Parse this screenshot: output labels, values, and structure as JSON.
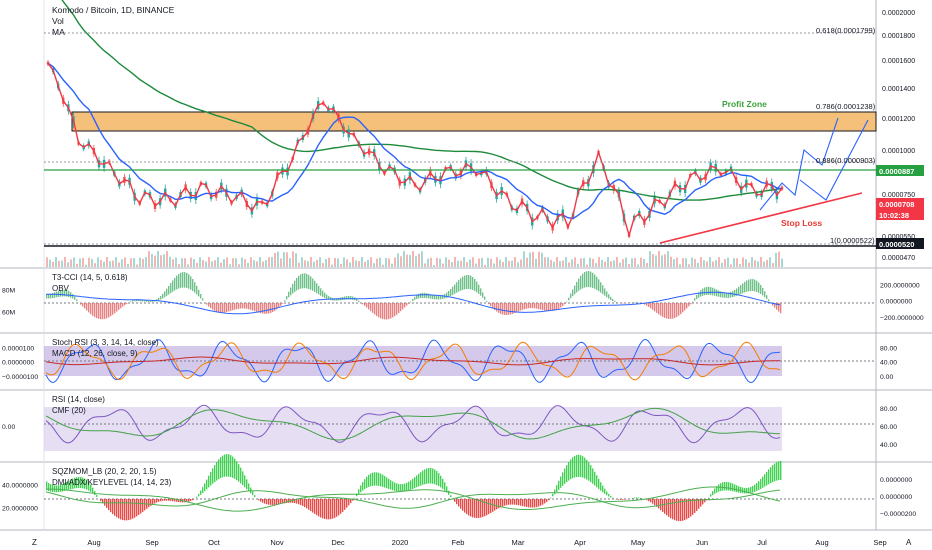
{
  "header": {
    "title": "Komodo / Bitcoin, 1D, BINANCE",
    "studies": [
      "Vol",
      "MA"
    ]
  },
  "colors": {
    "price_line": "#f23645",
    "ma_fast": "#2962ff",
    "ma_slow": "#1e8a3c",
    "zone_fill": "#f5c07a",
    "profit_text": "#3aa33a",
    "stop_text": "#e53935",
    "up": "#26a69a",
    "down": "#ef5350",
    "dark_label": "#131722",
    "green_label": "#26a040"
  },
  "annotations": {
    "profit_zone": "Profit Zone",
    "stop_loss": "Stop Loss"
  },
  "fib_levels": [
    {
      "label": "0.618(0.0001799)",
      "price": 0.0001799
    },
    {
      "label": "0.786(0.0001238)",
      "price": 0.0001238
    },
    {
      "label": "0.886(0.0000903)",
      "price": 9.03e-05
    },
    {
      "label": "1(0.0000522)",
      "price": 5.22e-05
    }
  ],
  "price_badges": [
    {
      "text": "0.0000887",
      "kind": "green"
    },
    {
      "text": "0.0000708",
      "kind": "red"
    },
    {
      "text": "10:02:38",
      "kind": "red"
    },
    {
      "text": "0.0000520",
      "kind": "dark"
    }
  ],
  "price_axis": [
    "0.0002000",
    "0.0001800",
    "0.0001600",
    "0.0001400",
    "0.0001200",
    "0.0001000",
    "0.0000850",
    "0.0000750",
    "0.0000650",
    "0.0000550",
    "0.0000470"
  ],
  "panels": {
    "t3cci": {
      "title": "T3-CCI (14, 5, 0.618)",
      "sub": "OBV",
      "left_ticks": [
        "80M",
        "60M"
      ],
      "right_ticks": [
        "200.0000000",
        "0.0000000",
        "−200.0000000"
      ]
    },
    "stoch": {
      "title": "Stoch RSI (3, 3, 14, 14, close)",
      "sub": "MACD (12, 26, close, 9)",
      "left_ticks": [
        "0.0000100",
        "0.0000000",
        "−0.0000100"
      ],
      "right_ticks": [
        "80.00",
        "40.00",
        "0.00"
      ]
    },
    "rsi": {
      "title": "RSI (14, close)",
      "sub": "CMF (20)",
      "left_ticks": [
        "0.00"
      ],
      "right_ticks": [
        "80.00",
        "60.00",
        "40.00"
      ]
    },
    "sqz": {
      "title": "SQZMOM_LB (20, 2, 20, 1.5)",
      "sub": "DMI/ADX/KEYLEVEL (14, 14, 23)",
      "left_ticks": [
        "40.0000000",
        "20.0000000"
      ],
      "right_ticks": [
        "0.0000000",
        "0.0000000",
        "−0.0000200"
      ]
    }
  },
  "time_axis": [
    "Aug",
    "Sep",
    "Oct",
    "Nov",
    "Dec",
    "2020",
    "Feb",
    "Mar",
    "Apr",
    "May",
    "Jun",
    "Jul",
    "Aug",
    "Sep"
  ],
  "corner_left": "Z",
  "corner_right": "A",
  "chart_data": {
    "type": "line",
    "title": "Komodo / Bitcoin, 1D, BINANCE",
    "x": [
      "Jul",
      "Aug",
      "Aug",
      "Sep",
      "Sep",
      "Oct",
      "Oct",
      "Nov",
      "Nov",
      "Dec",
      "Dec",
      "2020",
      "Jan",
      "Feb",
      "Feb",
      "Mar",
      "Mar",
      "Apr",
      "Apr",
      "May",
      "May",
      "Jun",
      "Jun",
      "Jul",
      "Jul"
    ],
    "series": [
      {
        "name": "",
        "values": [
          0.00015,
          9.5e-05,
          8e-05,
          6.7e-05,
          6.6e-05,
          7.1e-05,
          6.8e-05,
          6.3e-05,
          8.5e-05,
          0.00012,
          9.5e-05,
          8e-05,
          7.2e-05,
          7.8e-05,
          8e-05,
          6.6e-05,
          6e-05,
          5.8e-05,
          8.5e-05,
          5.6e-05,
          6.5e-05,
          7.5e-05,
          8e-05,
          7e-05,
          7.1e-05
        ]
      }
    ],
    "ylim": [
      4.6e-05,
      0.000205
    ],
    "xlabel": "",
    "ylabel": ""
  }
}
